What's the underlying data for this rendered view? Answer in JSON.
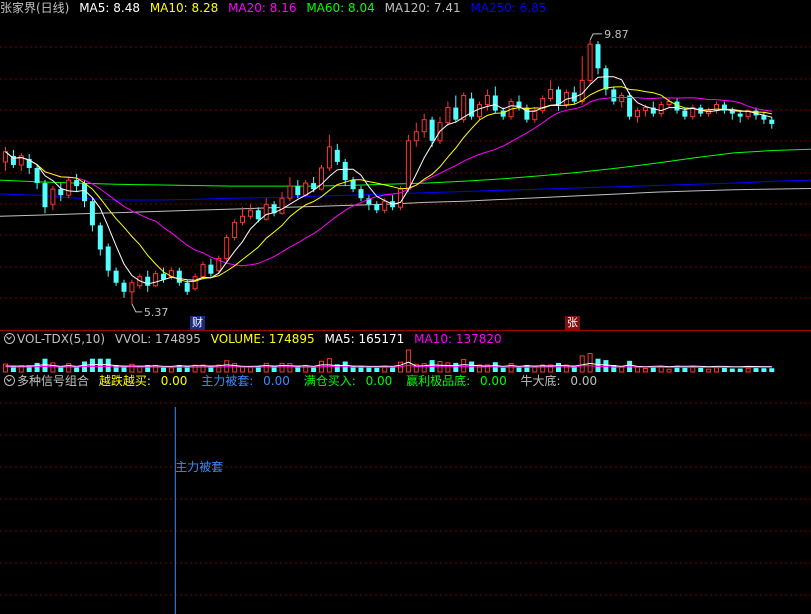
{
  "main_panel": {
    "title": "张家界(日线)",
    "indicators": [
      {
        "label": "MA5: 8.48",
        "color": "#ffffff"
      },
      {
        "label": "MA10: 8.28",
        "color": "#ffff00"
      },
      {
        "label": "MA20: 8.16",
        "color": "#ff00ff"
      },
      {
        "label": "MA60: 8.04",
        "color": "#00ff00"
      },
      {
        "label": "MA120: 7.41",
        "color": "#c0c0c0"
      },
      {
        "label": "MA250: 6.85",
        "color": "#0000ff"
      }
    ],
    "high_label": "9.87",
    "low_label": "5.37",
    "markers": [
      {
        "text": "财"
      },
      {
        "text": "张"
      }
    ]
  },
  "volume_panel": {
    "name": "VOL-TDX(5,10)",
    "items": [
      {
        "label": "VVOL: 174895",
        "color": "#c0c0c0"
      },
      {
        "label": "VOLUME: 174895",
        "color": "#ffff00"
      },
      {
        "label": "MA5: 165171",
        "color": "#ffffff"
      },
      {
        "label": "MA10: 137820",
        "color": "#ff00ff"
      }
    ]
  },
  "signal_panel": {
    "name": "多种信号组合",
    "items": [
      {
        "label": "越跌越买:",
        "value": "0.00",
        "color": "#ffff00"
      },
      {
        "label": "主力被套:",
        "value": "0.00",
        "color": "#3c8cff"
      },
      {
        "label": "满仓买入:",
        "value": "0.00",
        "color": "#00ff00"
      },
      {
        "label": "赢利极品底:",
        "value": "0.00",
        "color": "#00ff00"
      },
      {
        "label": "牛大底:",
        "value": "0.00",
        "color": "#c0c0c0"
      }
    ],
    "signal_text": "主力被套"
  },
  "colors": {
    "up": "#ff3232",
    "down": "#54ffff",
    "grid": "#800000",
    "ma5": "#ffffff",
    "ma10": "#ffff00",
    "ma20": "#ff00ff",
    "ma60": "#00ff00",
    "ma120": "#c0c0c0",
    "ma250": "#0000ff",
    "signal": "#3c8cff"
  },
  "chart_data": {
    "type": "candlestick",
    "candles": [
      [
        7.85,
        8.02,
        8.1,
        7.7
      ],
      [
        7.95,
        7.8,
        8.05,
        7.75
      ],
      [
        7.8,
        7.95,
        8.0,
        7.7
      ],
      [
        7.9,
        7.75,
        7.98,
        7.65
      ],
      [
        7.75,
        7.5,
        7.8,
        7.4
      ],
      [
        7.5,
        7.1,
        7.55,
        7.0
      ],
      [
        7.15,
        7.4,
        7.45,
        7.05
      ],
      [
        7.4,
        7.3,
        7.5,
        7.2
      ],
      [
        7.3,
        7.55,
        7.6,
        7.25
      ],
      [
        7.55,
        7.45,
        7.65,
        7.35
      ],
      [
        7.5,
        7.2,
        7.55,
        7.1
      ],
      [
        7.2,
        6.8,
        7.25,
        6.7
      ],
      [
        6.8,
        6.4,
        6.85,
        6.3
      ],
      [
        6.45,
        6.05,
        6.5,
        5.95
      ],
      [
        6.05,
        5.85,
        6.1,
        5.8
      ],
      [
        5.85,
        5.7,
        5.9,
        5.6
      ],
      [
        5.7,
        5.85,
        5.9,
        5.5
      ],
      [
        5.8,
        5.95,
        6.0,
        5.75
      ],
      [
        5.95,
        5.8,
        6.05,
        5.7
      ],
      [
        5.8,
        6.0,
        6.05,
        5.78
      ],
      [
        6.0,
        5.9,
        6.1,
        5.85
      ],
      [
        5.95,
        6.05,
        6.1,
        5.9
      ],
      [
        6.05,
        5.85,
        6.1,
        5.8
      ],
      [
        5.85,
        5.7,
        5.9,
        5.65
      ],
      [
        5.75,
        5.95,
        6.0,
        5.72
      ],
      [
        5.95,
        6.15,
        6.2,
        5.9
      ],
      [
        6.15,
        6.0,
        6.25,
        5.95
      ],
      [
        6.05,
        6.25,
        6.3,
        6.0
      ],
      [
        6.25,
        6.6,
        6.65,
        6.2
      ],
      [
        6.6,
        6.85,
        6.9,
        6.55
      ],
      [
        6.85,
        6.95,
        7.1,
        6.8
      ],
      [
        6.95,
        7.05,
        7.15,
        6.9
      ],
      [
        7.05,
        6.9,
        7.1,
        6.85
      ],
      [
        6.9,
        7.15,
        7.25,
        6.88
      ],
      [
        7.15,
        7.0,
        7.2,
        6.95
      ],
      [
        7.0,
        7.25,
        7.35,
        6.98
      ],
      [
        7.25,
        7.45,
        7.6,
        7.2
      ],
      [
        7.45,
        7.3,
        7.55,
        7.25
      ],
      [
        7.3,
        7.5,
        7.55,
        7.28
      ],
      [
        7.5,
        7.4,
        7.6,
        7.35
      ],
      [
        7.4,
        7.75,
        7.8,
        7.38
      ],
      [
        7.75,
        8.1,
        8.3,
        7.7
      ],
      [
        8.05,
        7.85,
        8.15,
        7.8
      ],
      [
        7.85,
        7.55,
        7.9,
        7.45
      ],
      [
        7.55,
        7.4,
        7.6,
        7.35
      ],
      [
        7.4,
        7.25,
        7.45,
        7.2
      ],
      [
        7.25,
        7.15,
        7.3,
        7.05
      ],
      [
        7.15,
        7.05,
        7.2,
        7.0
      ],
      [
        7.05,
        7.2,
        7.25,
        7.0
      ],
      [
        7.2,
        7.1,
        7.3,
        7.05
      ],
      [
        7.1,
        7.4,
        7.45,
        7.05
      ],
      [
        7.4,
        8.2,
        8.3,
        7.35
      ],
      [
        8.2,
        8.35,
        8.5,
        8.1
      ],
      [
        8.35,
        8.55,
        8.65,
        8.25
      ],
      [
        8.55,
        8.2,
        8.6,
        8.1
      ],
      [
        8.2,
        8.5,
        8.6,
        8.15
      ],
      [
        8.5,
        8.75,
        8.85,
        8.45
      ],
      [
        8.75,
        8.55,
        8.95,
        8.5
      ],
      [
        8.55,
        8.95,
        9.0,
        8.5
      ],
      [
        8.9,
        8.6,
        9.0,
        8.55
      ],
      [
        8.6,
        8.8,
        8.85,
        8.55
      ],
      [
        8.8,
        8.95,
        9.05,
        8.7
      ],
      [
        8.95,
        8.7,
        9.1,
        8.65
      ],
      [
        8.7,
        8.6,
        8.75,
        8.55
      ],
      [
        8.6,
        8.85,
        8.9,
        8.55
      ],
      [
        8.85,
        8.75,
        8.95,
        8.7
      ],
      [
        8.75,
        8.55,
        8.8,
        8.5
      ],
      [
        8.55,
        8.7,
        8.75,
        8.5
      ],
      [
        8.7,
        8.9,
        8.95,
        8.65
      ],
      [
        8.9,
        9.05,
        9.2,
        8.85
      ],
      [
        9.05,
        8.8,
        9.1,
        8.7
      ],
      [
        8.8,
        9.0,
        9.05,
        8.75
      ],
      [
        9.0,
        8.85,
        9.1,
        8.8
      ],
      [
        8.85,
        9.2,
        9.6,
        8.8
      ],
      [
        9.2,
        9.8,
        9.87,
        9.15
      ],
      [
        9.8,
        9.4,
        9.85,
        9.3
      ],
      [
        9.4,
        9.05,
        9.45,
        8.95
      ],
      [
        9.05,
        8.85,
        9.1,
        8.8
      ],
      [
        8.85,
        8.95,
        9.0,
        8.75
      ],
      [
        8.95,
        8.6,
        9.0,
        8.55
      ],
      [
        8.6,
        8.7,
        8.75,
        8.5
      ],
      [
        8.7,
        8.75,
        8.8,
        8.6
      ],
      [
        8.75,
        8.65,
        8.85,
        8.6
      ],
      [
        8.65,
        8.8,
        8.85,
        8.6
      ],
      [
        8.8,
        8.85,
        8.9,
        8.75
      ],
      [
        8.85,
        8.7,
        8.9,
        8.65
      ],
      [
        8.7,
        8.6,
        8.75,
        8.55
      ],
      [
        8.6,
        8.75,
        8.8,
        8.55
      ],
      [
        8.75,
        8.65,
        8.8,
        8.6
      ],
      [
        8.65,
        8.7,
        8.75,
        8.6
      ],
      [
        8.7,
        8.8,
        8.85,
        8.65
      ],
      [
        8.8,
        8.7,
        8.85,
        8.65
      ],
      [
        8.7,
        8.65,
        8.75,
        8.55
      ],
      [
        8.65,
        8.6,
        8.7,
        8.5
      ],
      [
        8.6,
        8.7,
        8.72,
        8.55
      ],
      [
        8.7,
        8.62,
        8.75,
        8.55
      ],
      [
        8.62,
        8.55,
        8.68,
        8.48
      ],
      [
        8.55,
        8.48,
        8.6,
        8.4
      ]
    ],
    "ma60": [
      7.55,
      7.52,
      7.5,
      7.48,
      7.47,
      7.46,
      7.45,
      7.45,
      7.45,
      7.46,
      7.48,
      7.5,
      7.53,
      7.57,
      7.62,
      7.68,
      7.75,
      7.83,
      7.92,
      8.0,
      8.04,
      8.06
    ],
    "ma120": [
      6.95,
      6.97,
      6.99,
      7.01,
      7.03,
      7.05,
      7.07,
      7.09,
      7.11,
      7.13,
      7.15,
      7.18,
      7.2,
      7.23,
      7.26,
      7.29,
      7.32,
      7.35,
      7.37,
      7.39,
      7.4,
      7.41
    ],
    "ma250": [
      7.32,
      7.3,
      7.25,
      7.22,
      7.22,
      7.23,
      7.25,
      7.26,
      7.28,
      7.3,
      7.32,
      7.34,
      7.36,
      7.38,
      7.4,
      7.42,
      7.44,
      7.46,
      7.48,
      7.5,
      7.53,
      7.55
    ],
    "price_range": [
      5.2,
      10.2
    ],
    "signal_index": 22
  }
}
